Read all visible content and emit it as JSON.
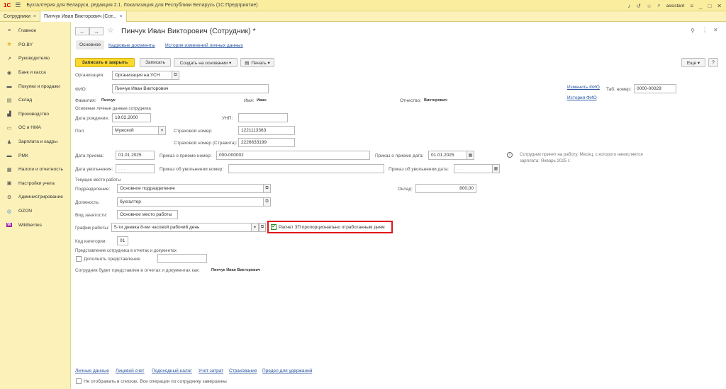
{
  "app": {
    "logo": "1С",
    "title": "Бухгалтерия для Беларуси, редакция 2.1. Локализация для Республики Беларусь   (1С:Предприятие)",
    "user": "assistant"
  },
  "tabs": [
    {
      "label": "Сотрудники",
      "close": "×"
    },
    {
      "label": "Пинчук Иван Викторович (Сот...",
      "close": "×"
    }
  ],
  "sidebar": [
    {
      "label": "Главное",
      "icon": "≡"
    },
    {
      "label": "PO.BY",
      "icon": "✲"
    },
    {
      "label": "Руководителю",
      "icon": "↗"
    },
    {
      "label": "Банк и касса",
      "icon": "◉"
    },
    {
      "label": "Покупки и продажи",
      "icon": "▬"
    },
    {
      "label": "Склад",
      "icon": "▤"
    },
    {
      "label": "Производство",
      "icon": "▟"
    },
    {
      "label": "ОС и НМА",
      "icon": "▭"
    },
    {
      "label": "Зарплата и кадры",
      "icon": "♟"
    },
    {
      "label": "РМК",
      "icon": "▬"
    },
    {
      "label": "Налоги и отчетность",
      "icon": "▦"
    },
    {
      "label": "Настройки учета",
      "icon": "▣"
    },
    {
      "label": "Администрирование",
      "icon": "⚙"
    },
    {
      "label": "OZON",
      "icon": "◎"
    },
    {
      "label": "Wildberries",
      "icon": "W"
    }
  ],
  "form": {
    "title": "Пинчук Иван Викторович (Сотрудник) *",
    "subtabs": [
      "Основное",
      "Кадровые документы",
      "История изменений личных данных"
    ],
    "buttons": {
      "save_close": "Записать и закрыть",
      "save": "Записать",
      "create_basis": "Создать на основании ▾",
      "print": "Печать ▾",
      "more": "Еще ▾",
      "help": "?"
    },
    "org_label": "Организация:",
    "org_value": "Организация на УСН",
    "fio_label": "ФИО:",
    "fio_value": "Пинчук Иван Викторович",
    "change_fio": "Изменить ФИО",
    "fio_history": "История ФИО",
    "tab_num_label": "Таб. номер:",
    "tab_num_value": "0000-00029",
    "surname_label": "Фамилия:",
    "surname_value": "Пинчук",
    "name_label": "Имя:",
    "name_value": "Иван",
    "patronymic_label": "Отчество:",
    "patronymic_value": "Викторович",
    "personal_section": "Основные личные данные сотрудника",
    "birth_label": "Дата рождения:",
    "birth_value": "19.02.2000",
    "unp_label": "УНП:",
    "unp_value": "",
    "gender_label": "Пол:",
    "gender_value": "Мужской",
    "ins_label": "Страховой номер:",
    "ins_value": "1221113363",
    "ins2_label": "Страховой номер (Стравита):",
    "ins2_value": "2226633199",
    "hire_date_label": "Дата приема:",
    "hire_date_value": "01.01.2025",
    "hire_order_label": "Приказ о приеме номер:",
    "hire_order_value": "000-000002",
    "hire_order_date_label": "Приказ о приеме дата:",
    "hire_order_date_value": "01.01.2025",
    "info_text": "Сотрудник принят на работу. Месяц, с которого начисляется зарплата: Январь 2025 г.",
    "dismiss_label": "Дата увольнения:",
    "dismiss_value": ". . .",
    "dismiss_order_label": "Приказ об увольнении номер:",
    "dismiss_order_date_label": "Приказ об увольнении дата:",
    "dismiss_order_date_value": ". . .",
    "job_section": "Текущее место работы",
    "dept_label": "Подразделение:",
    "dept_value": "Основное подразделение",
    "salary_label": "Оклад:",
    "salary_value": "800,00",
    "position_label": "Должность:",
    "position_value": "бухгалтер",
    "employment_label": "Вид занятости:",
    "employment_value": "Основное место работы",
    "schedule_label": "График работы:",
    "schedule_value": "5-ти дневка 8-ми часовой рабочий день",
    "proportional_label": "Расчет ЗП пропорционально отработанным дням",
    "category_label": "Код категории:",
    "category_value": "01",
    "repr_section": "Представление сотрудника в отчетах и документах",
    "repr_extend_label": "Дополнять представление",
    "repr_text": "Сотрудник будет представлен в отчетах и документах как:",
    "repr_value": "Пинчук Иван Викторович",
    "bottom_links": [
      "Личные данные",
      "Лицевой счет",
      "Подоходный налог",
      "Учет затрат",
      "Страхование",
      "Предел для удержаний"
    ],
    "hide_label": "Не отображать в списках. Все операции по сотруднику завершены"
  },
  "colors": {
    "accent": "#fcd92e",
    "highlight": "#e0161b",
    "sidebar": "#fbf1b9",
    "link": "#2a55a0"
  }
}
